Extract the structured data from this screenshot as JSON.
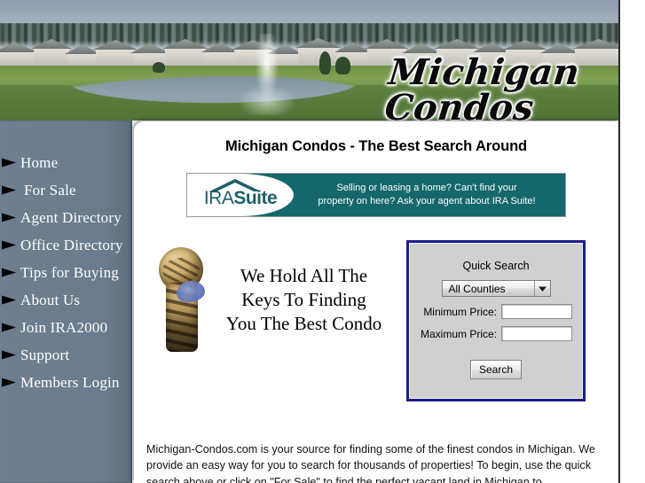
{
  "header": {
    "logo_text": "Michigan Condos",
    "image_alt": "condo-community-pond-fountain-photo"
  },
  "sidebar": {
    "items": [
      {
        "label": "Home",
        "icon": "triangle-bullet-icon"
      },
      {
        "label": "For Sale",
        "icon": "triangle-bullet-icon"
      },
      {
        "label": "Agent Directory",
        "icon": "triangle-bullet-icon"
      },
      {
        "label": "Office Directory",
        "icon": "triangle-bullet-icon"
      },
      {
        "label": "Tips for Buying",
        "icon": "triangle-bullet-icon"
      },
      {
        "label": "About Us",
        "icon": "triangle-bullet-icon"
      },
      {
        "label": "Join IRA2000",
        "icon": "triangle-bullet-icon"
      },
      {
        "label": "Support",
        "icon": "triangle-bullet-icon"
      },
      {
        "label": "Members Login",
        "icon": "triangle-bullet-icon"
      }
    ]
  },
  "main": {
    "title": "Michigan Condos - The Best Search Around",
    "promo": {
      "logo_prefix": "IRA",
      "logo_suffix": "Suite",
      "line1": "Selling or leasing a home?  Can't find your",
      "line2": "property on here?  Ask your agent about IRA Suite!",
      "bg_color": "#14676b"
    },
    "tagline": {
      "line1": "We Hold All The",
      "line2": "Keys To Finding",
      "line3": "You The Best Condo",
      "image": "keyhole-icon"
    },
    "quick_search": {
      "title": "Quick Search",
      "county_selected": "All Counties",
      "min_price_label": "Minimum Price:",
      "min_price_value": "",
      "min_price_placeholder": "",
      "max_price_label": "Maximum Price:",
      "max_price_value": "",
      "max_price_placeholder": "",
      "search_button": "Search",
      "border_color": "#1d1d8d"
    },
    "intro_text": "Michigan-Condos.com is your source for finding some of the finest condos in Michigan. We provide an easy way for you to search for thousands of properties! To begin, use the quick search above or click on \"For Sale\" to find the perfect vacant land in Michigan to"
  }
}
